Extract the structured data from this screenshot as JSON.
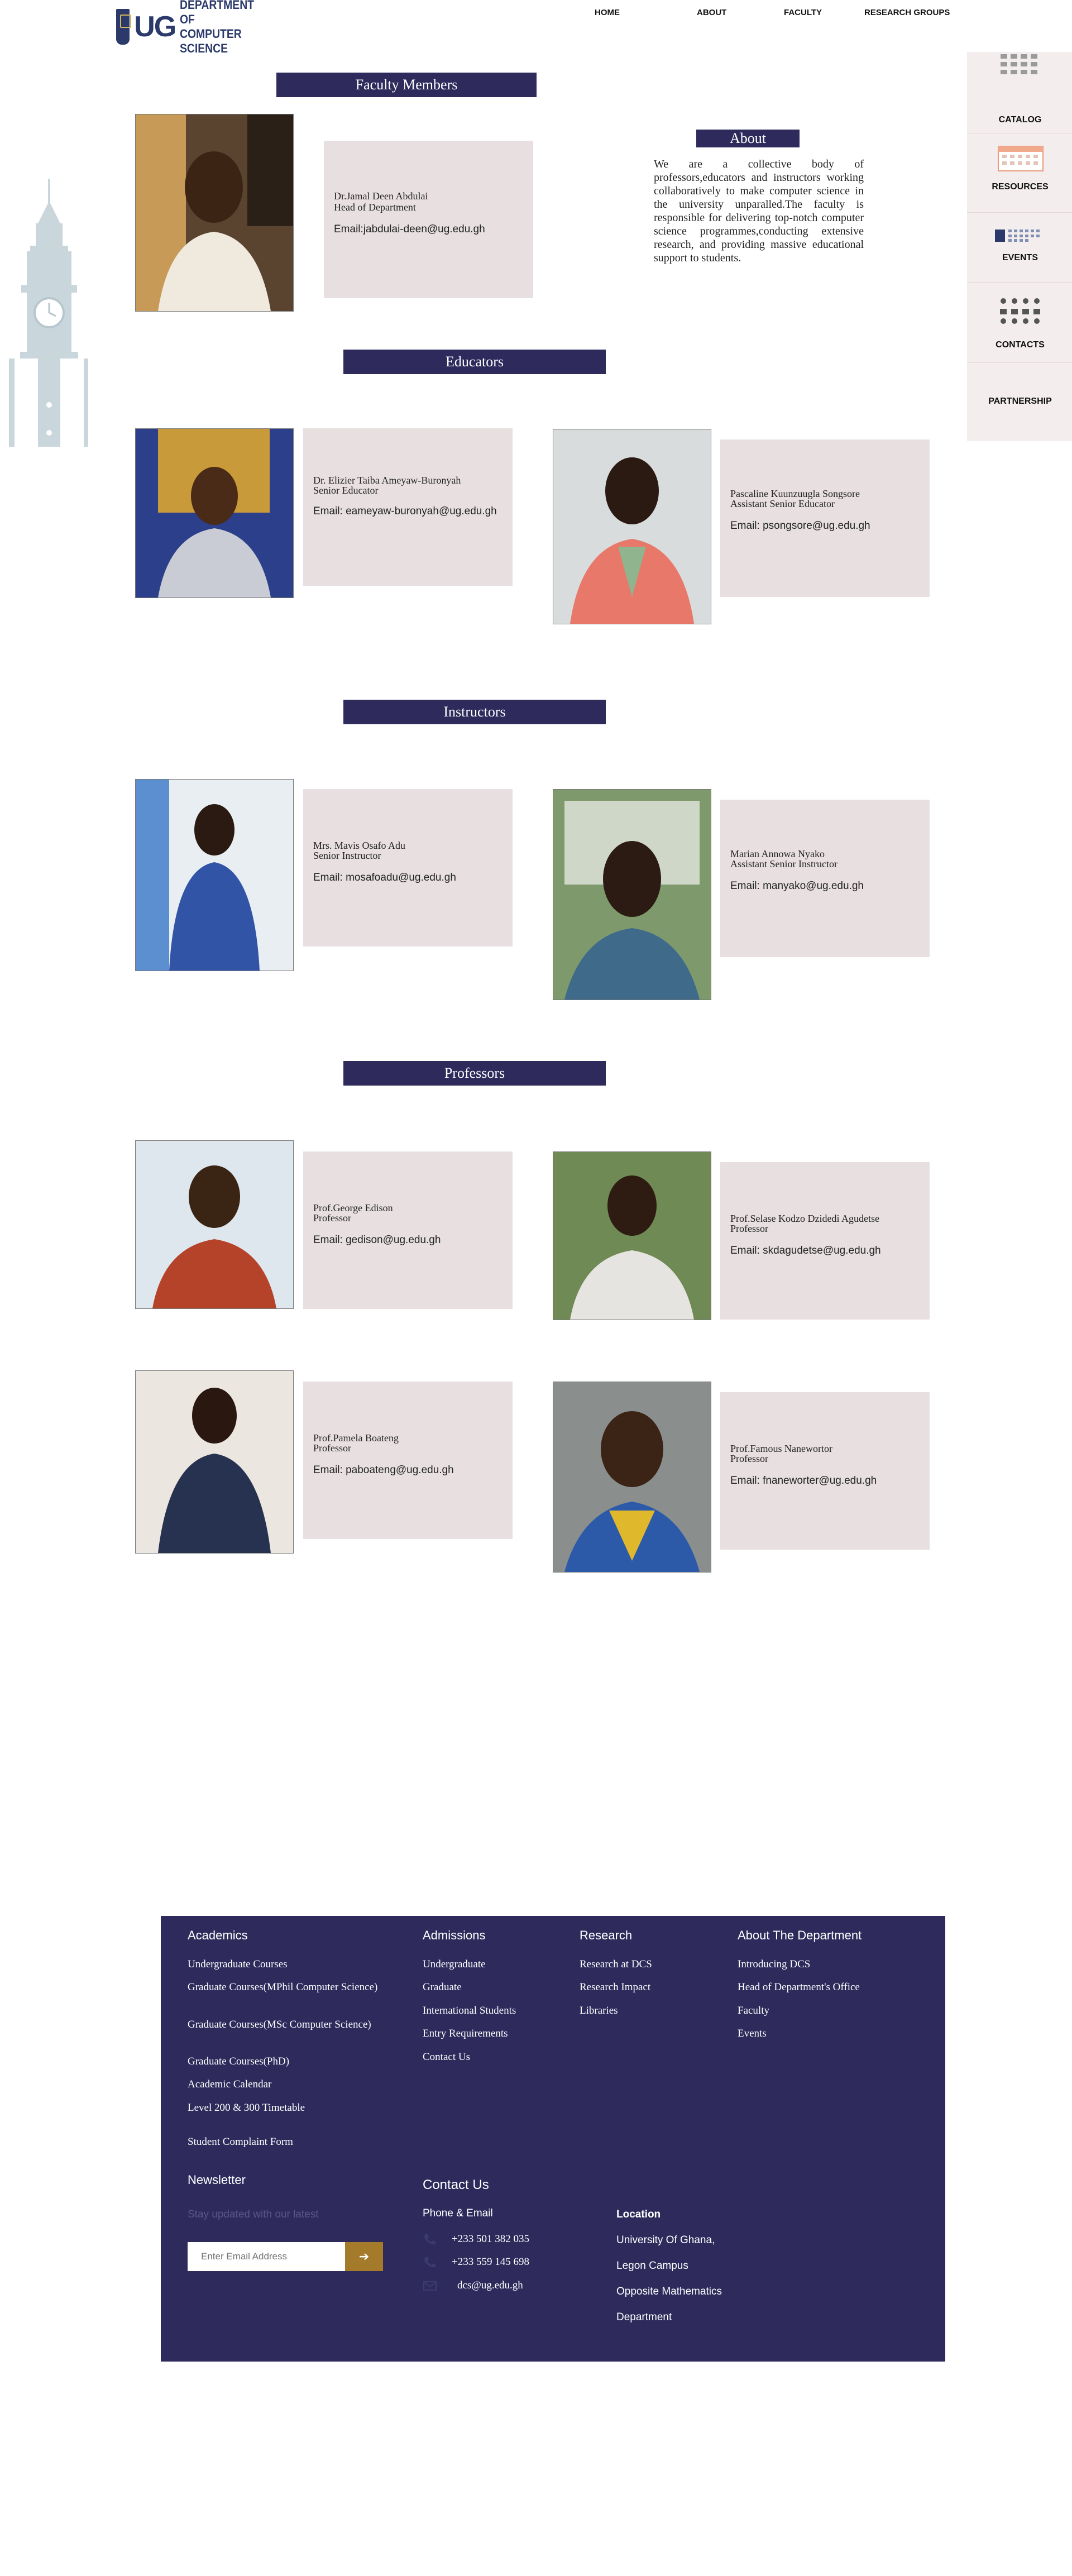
{
  "header": {
    "logo_letters": "UG",
    "logo_line1": "DEPARTMENT OF",
    "logo_line2": "COMPUTER SCIENCE",
    "nav": [
      "HOME",
      "ABOUT",
      "FACULTY",
      "RESEARCH GROUPS"
    ]
  },
  "sidebar": [
    "CATALOG",
    "RESOURCES",
    "EVENTS",
    "CONTACTS",
    "PARTNERSHIP"
  ],
  "sections": {
    "faculty": "Faculty Members",
    "educators": "Educators",
    "instructors": "Instructors",
    "professors": "Professors"
  },
  "about": {
    "title": "About",
    "body": "We are a collective body of professors,educators and instructors working collaboratively to make computer science in the university unparalled.The faculty is responsible for delivering top-notch computer science programmes,conducting extensive research, and providing massive educational support to students."
  },
  "people": {
    "hod": {
      "name": "Dr.Jamal Deen Abdulai",
      "role": "Head of Department",
      "email": "Email:jabdulai-deen@ug.edu.gh"
    },
    "edu1": {
      "name": "Dr. Elizier Taiba Ameyaw-Buronyah",
      "role": "Senior Educator",
      "email": "Email: eameyaw-buronyah@ug.edu.gh"
    },
    "edu2": {
      "name": "Pascaline Kuunzuugla Songsore",
      "role": "Assistant Senior Educator",
      "email": "Email: psongsore@ug.edu.gh"
    },
    "ins1": {
      "name": "Mrs. Mavis Osafo Adu",
      "role": "Senior Instructor",
      "email": "Email: mosafoadu@ug.edu.gh"
    },
    "ins2": {
      "name": "Marian Annowa Nyako",
      "role": "Assistant Senior Instructor",
      "email": "Email: manyako@ug.edu.gh"
    },
    "pro1": {
      "name": "Prof.George Edison",
      "role": "Professor",
      "email": "Email: gedison@ug.edu.gh"
    },
    "pro2": {
      "name": "Prof.Selase Kodzo Dzidedi Agudetse",
      "role": "Professor",
      "email": "Email: skdagudetse@ug.edu.gh"
    },
    "pro3": {
      "name": "Prof.Pamela Boateng",
      "role": "Professor",
      "email": "Email: paboateng@ug.edu.gh"
    },
    "pro4": {
      "name": "Prof.Famous Nanewortor",
      "role": "Professor",
      "email": "Email: fnaneworter@ug.edu.gh"
    }
  },
  "footer": {
    "academics": {
      "title": "Academics",
      "links": [
        "Undergraduate Courses",
        "Graduate Courses(MPhil Computer Science)",
        "Graduate Courses(MSc Computer Science)",
        "Graduate Courses(PhD)",
        "Academic Calendar",
        "Level 200 & 300 Timetable",
        "Student Complaint Form"
      ]
    },
    "admissions": {
      "title": "Admissions",
      "links": [
        "Undergraduate",
        "Graduate",
        "International Students",
        "Entry Requirements",
        "Contact Us"
      ]
    },
    "research": {
      "title": "Research",
      "links": [
        "Research at DCS",
        "Research Impact",
        "Libraries"
      ]
    },
    "about": {
      "title": "About The Department",
      "links": [
        "Introducing DCS",
        "Head of Department's Office",
        "Faculty",
        "Events"
      ]
    },
    "newsletter": {
      "title": "Newsletter",
      "subtitle": "Stay updated with our latest",
      "placeholder": "Enter Email Address",
      "button": "➔"
    },
    "contact": {
      "title": "Contact Us",
      "subtitle": "Phone & Email",
      "phone1": "+233 501 382 035",
      "phone2": "+233 559 145 698",
      "email": "dcs@ug.edu.gh"
    },
    "location": {
      "title": "Location",
      "lines": [
        "University Of Ghana,",
        "Legon Campus",
        "Opposite Mathematics",
        "Department"
      ]
    }
  },
  "colors": {
    "navy": "#2e2b5c",
    "card": "#e7dfe0",
    "gold": "#a47a2b"
  }
}
